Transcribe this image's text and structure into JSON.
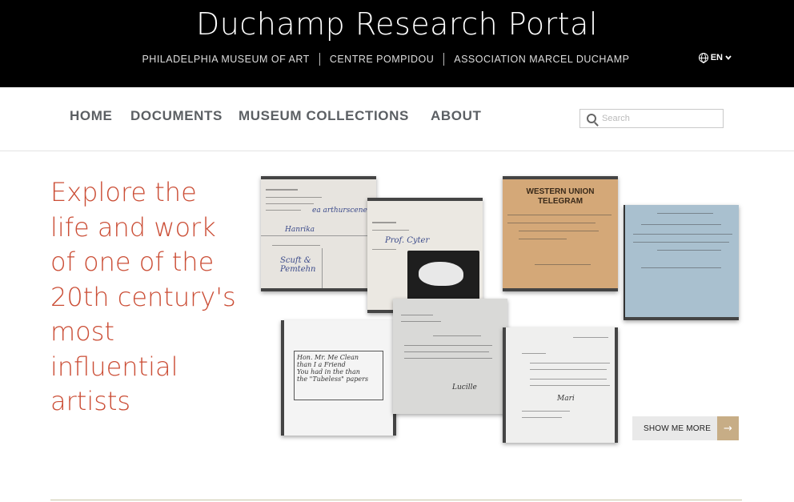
{
  "header": {
    "title": "Duchamp Research Portal",
    "partners": [
      "PHILADELPHIA MUSEUM OF ART",
      "CENTRE POMPIDOU",
      "ASSOCIATION MARCEL DUCHAMP"
    ],
    "language": "EN"
  },
  "nav": {
    "items": [
      "HOME",
      "DOCUMENTS",
      "MUSEUM COLLECTIONS",
      "ABOUT"
    ],
    "search_placeholder": "Search"
  },
  "hero": {
    "tagline": "Explore the life and work of one of the 20th century's most influential artists",
    "show_more_label": "SHOW ME MORE",
    "arrow_icon": "→"
  },
  "documents": {
    "telegram_line1": "WESTERN UNION",
    "telegram_line2": "TELEGRAM"
  },
  "colors": {
    "header_bg": "#000000",
    "accent": "#cb4e36",
    "button_accent": "#c7ad86",
    "nav_text": "#5b5f63"
  }
}
